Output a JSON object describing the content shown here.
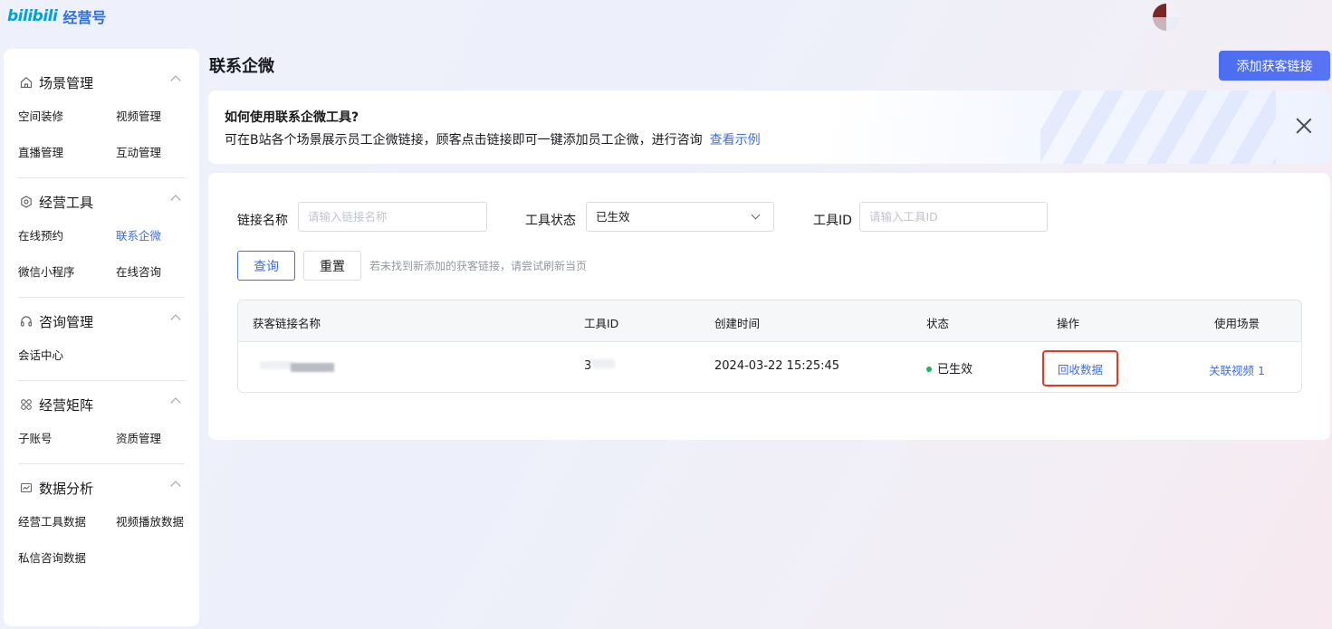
{
  "brand": {
    "logo_mark": "bilibili",
    "product": "经营号"
  },
  "sidebar": {
    "groups": [
      {
        "title": "场景管理",
        "icon": "home-icon",
        "items": [
          "空间装修",
          "视频管理",
          "直播管理",
          "互动管理"
        ]
      },
      {
        "title": "经营工具",
        "icon": "settings-icon",
        "items": [
          "在线预约",
          "联系企微",
          "微信小程序",
          "在线咨询"
        ]
      },
      {
        "title": "咨询管理",
        "icon": "headset-icon",
        "items": [
          "会话中心"
        ]
      },
      {
        "title": "经营矩阵",
        "icon": "grid-icon",
        "items": [
          "子账号",
          "资质管理"
        ]
      },
      {
        "title": "数据分析",
        "icon": "chart-icon",
        "items": [
          "经营工具数据",
          "视频播放数据",
          "私信咨询数据"
        ]
      }
    ],
    "active_item": "联系企微"
  },
  "header": {
    "title": "联系企微",
    "add_button": "添加获客链接"
  },
  "tip": {
    "title": "如何使用联系企微工具?",
    "text": "可在B站各个场景展示员工企微链接，顾客点击链接即可一键添加员工企微，进行咨询",
    "link": "查看示例"
  },
  "filters": {
    "link_name": {
      "label": "链接名称",
      "placeholder": "请输入链接名称"
    },
    "status": {
      "label": "工具状态",
      "value": "已生效"
    },
    "tool_id": {
      "label": "工具ID",
      "placeholder": "请输入工具ID"
    },
    "query_button": "查询",
    "reset_button": "重置",
    "hint": "若未找到新添加的获客链接，请尝试刷新当页"
  },
  "table": {
    "headers": [
      "获客链接名称",
      "工具ID",
      "创建时间",
      "状态",
      "操作",
      "使用场景"
    ],
    "rows": [
      {
        "name": "",
        "tool_id": "3",
        "created": "2024-03-22 15:25:45",
        "status": "已生效",
        "action": "回收数据",
        "scene": "关联视频 1"
      }
    ]
  },
  "colors": {
    "primary": "#3d6fe8",
    "status_green": "#1fb856",
    "highlight_red": "#e13a24"
  }
}
